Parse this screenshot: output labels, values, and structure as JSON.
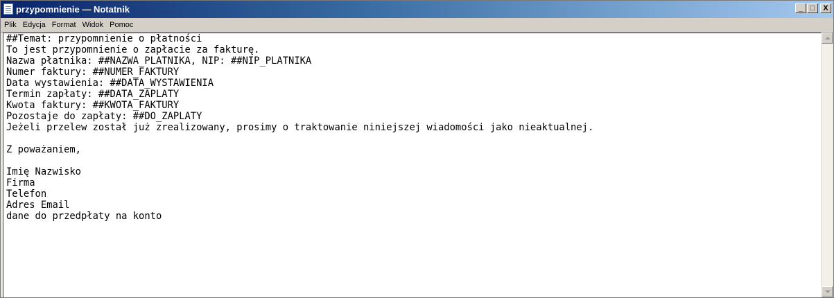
{
  "window": {
    "title": "przypomnienie — Notatnik",
    "controls": {
      "minimize": "_",
      "maximize": "□",
      "close": "X"
    }
  },
  "menu": [
    "Plik",
    "Edycja",
    "Format",
    "Widok",
    "Pomoc"
  ],
  "editor": {
    "lines": [
      "##Temat: przypomnienie o płatności",
      "To jest przypomnienie o zapłacie za fakturę.",
      "Nazwa płatnika: ##NAZWA_PLATNIKA, NIP: ##NIP_PLATNIKA",
      "Numer faktury: ##NUMER_FAKTURY",
      "Data wystawienia: ##DATA_WYSTAWIENIA",
      "Termin zapłaty: ##DATA_ZAPLATY",
      "Kwota faktury: ##KWOTA_FAKTURY",
      "Pozostaje do zapłaty: ##DO_ZAPLATY",
      "Jeżeli przelew został już zrealizowany, prosimy o traktowanie niniejszej wiadomości jako nieaktualnej.",
      "",
      "Z poważaniem,",
      "",
      "Imię Nazwisko",
      "Firma",
      "Telefon",
      "Adres Email",
      "dane do przedpłaty na konto"
    ]
  },
  "icons": {
    "app": "notepad-icon",
    "scroll_up": "scroll-up-arrow-icon",
    "scroll_down": "scroll-down-arrow-icon"
  }
}
